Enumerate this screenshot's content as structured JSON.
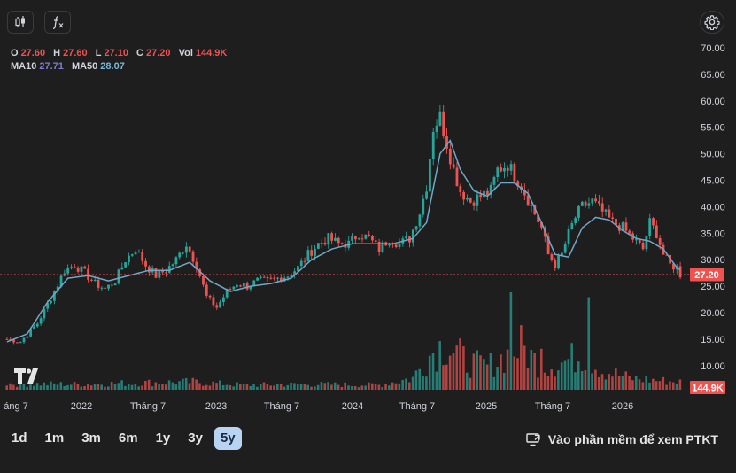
{
  "legend": {
    "open_label": "O",
    "open": "27.60",
    "high_label": "H",
    "high": "27.60",
    "low_label": "L",
    "low": "27.10",
    "close_label": "C",
    "close": "27.20",
    "vol_label": "Vol",
    "vol": "144.9K",
    "ma10_label": "MA10",
    "ma10": "27.71",
    "ma50_label": "MA50",
    "ma50": "28.07"
  },
  "chart_data": {
    "type": "candlestick",
    "x_labels": [
      "áng 7",
      "2022",
      "Tháng 7",
      "2023",
      "Tháng 7",
      "2024",
      "Tháng 7",
      "2025",
      "Tháng 7",
      "2026"
    ],
    "y_ticks": [
      "70.00",
      "65.00",
      "60.00",
      "55.00",
      "50.00",
      "45.00",
      "40.00",
      "35.00",
      "30.00",
      "25.00",
      "20.00",
      "15.00",
      "10.00"
    ],
    "ylim": [
      8,
      71
    ],
    "last_price": "27.20",
    "last_volume": "144.9K",
    "price_path": [
      [
        0,
        15
      ],
      [
        4,
        14.5
      ],
      [
        9,
        18
      ],
      [
        14,
        24
      ],
      [
        17,
        28
      ],
      [
        20,
        29
      ],
      [
        23,
        27.5
      ],
      [
        26,
        25.5
      ],
      [
        29,
        24.5
      ],
      [
        32,
        26
      ],
      [
        35,
        30
      ],
      [
        38,
        32
      ],
      [
        41,
        29
      ],
      [
        44,
        27
      ],
      [
        47,
        28
      ],
      [
        50,
        30
      ],
      [
        53,
        33
      ],
      [
        56,
        29
      ],
      [
        59,
        23
      ],
      [
        62,
        21
      ],
      [
        65,
        24
      ],
      [
        68,
        25.5
      ],
      [
        71,
        25
      ],
      [
        74,
        26
      ],
      [
        77,
        26
      ],
      [
        80,
        26.5
      ],
      [
        83,
        27
      ],
      [
        86,
        28.5
      ],
      [
        89,
        31
      ],
      [
        92,
        33
      ],
      [
        95,
        34
      ],
      [
        98,
        33
      ],
      [
        101,
        33
      ],
      [
        104,
        35
      ],
      [
        107,
        34
      ],
      [
        110,
        32
      ],
      [
        113,
        34
      ],
      [
        116,
        33
      ],
      [
        119,
        34
      ],
      [
        122,
        39
      ],
      [
        124,
        44
      ],
      [
        126,
        55
      ],
      [
        128,
        57
      ],
      [
        130,
        52
      ],
      [
        132,
        47
      ],
      [
        134,
        43
      ],
      [
        137,
        41
      ],
      [
        140,
        42
      ],
      [
        143,
        43
      ],
      [
        145,
        47
      ],
      [
        148,
        48
      ],
      [
        150,
        46
      ],
      [
        152,
        44
      ],
      [
        155,
        40
      ],
      [
        158,
        36
      ],
      [
        160,
        31
      ],
      [
        162,
        29
      ],
      [
        164,
        31
      ],
      [
        166,
        35
      ],
      [
        168,
        38
      ],
      [
        170,
        40
      ],
      [
        173,
        41
      ],
      [
        176,
        39
      ],
      [
        179,
        37
      ],
      [
        182,
        36
      ],
      [
        185,
        34
      ],
      [
        188,
        32
      ],
      [
        190,
        37
      ],
      [
        192,
        35
      ],
      [
        194,
        31
      ],
      [
        196,
        29
      ],
      [
        198,
        28.5
      ],
      [
        199,
        27.2
      ]
    ],
    "ma50_path": [
      [
        0,
        14.5
      ],
      [
        6,
        16
      ],
      [
        12,
        22
      ],
      [
        18,
        26.5
      ],
      [
        24,
        27
      ],
      [
        30,
        26
      ],
      [
        36,
        27
      ],
      [
        42,
        28
      ],
      [
        48,
        28
      ],
      [
        54,
        29.5
      ],
      [
        60,
        26
      ],
      [
        66,
        24
      ],
      [
        72,
        25
      ],
      [
        78,
        25.5
      ],
      [
        84,
        26.5
      ],
      [
        90,
        30
      ],
      [
        96,
        32
      ],
      [
        102,
        33
      ],
      [
        108,
        33
      ],
      [
        114,
        33
      ],
      [
        120,
        34
      ],
      [
        124,
        37
      ],
      [
        128,
        50
      ],
      [
        131,
        52.5
      ],
      [
        134,
        47
      ],
      [
        138,
        43
      ],
      [
        142,
        42
      ],
      [
        146,
        44.5
      ],
      [
        150,
        44.5
      ],
      [
        154,
        42.5
      ],
      [
        158,
        37
      ],
      [
        162,
        31
      ],
      [
        166,
        30.5
      ],
      [
        170,
        36
      ],
      [
        174,
        38
      ],
      [
        178,
        37.5
      ],
      [
        182,
        35.5
      ],
      [
        186,
        34
      ],
      [
        190,
        33.5
      ],
      [
        194,
        32
      ],
      [
        198,
        28.5
      ],
      [
        199,
        28.07
      ]
    ],
    "volume_path": [
      [
        0,
        0.08
      ],
      [
        20,
        0.07
      ],
      [
        40,
        0.09
      ],
      [
        55,
        0.1
      ],
      [
        70,
        0.06
      ],
      [
        90,
        0.07
      ],
      [
        110,
        0.06
      ],
      [
        120,
        0.15
      ],
      [
        126,
        0.5
      ],
      [
        130,
        0.6
      ],
      [
        136,
        0.35
      ],
      [
        142,
        0.3
      ],
      [
        148,
        0.45
      ],
      [
        152,
        0.55
      ],
      [
        158,
        0.3
      ],
      [
        164,
        0.35
      ],
      [
        170,
        0.45
      ],
      [
        176,
        0.25
      ],
      [
        184,
        0.15
      ],
      [
        192,
        0.12
      ],
      [
        199,
        0.1
      ]
    ],
    "bar_count": 200,
    "volume_spikes": [
      [
        149,
        1.0
      ],
      [
        158,
        0.42
      ],
      [
        172,
        0.95
      ]
    ],
    "colors": {
      "up": "#26a69a",
      "down": "#ef5350",
      "ma50": "#6fa8c8",
      "price_line": "#ef5350"
    }
  },
  "periods": [
    "1d",
    "1m",
    "3m",
    "6m",
    "1y",
    "3y",
    "5y"
  ],
  "active_period": "5y",
  "analysis_link": "Vào phần mềm để xem PTKT"
}
